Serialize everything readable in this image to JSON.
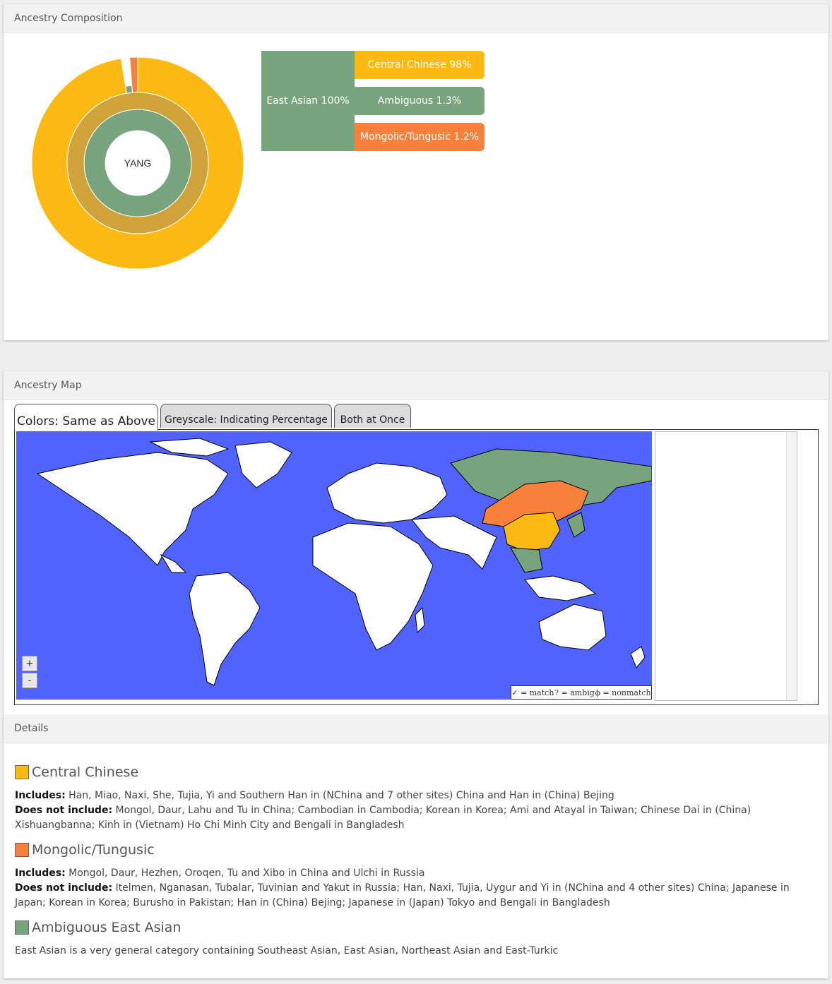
{
  "composition": {
    "header": "Ancestry Composition",
    "center_label": "YANG",
    "colors": {
      "central": "#fdb913",
      "ambiguous": "#78a47d",
      "mongolic": "#f7803b",
      "east_asian_ring": "#cfa23a"
    },
    "top_level": {
      "label": "East Asian 100%",
      "value": 100
    },
    "subgroups": [
      {
        "label": "Central Chinese 98%",
        "value": 97.5,
        "color": "#fdb913"
      },
      {
        "label": "Ambiguous 1.3%",
        "value": 1.3,
        "color": "#78a47d"
      },
      {
        "label": "Mongolic/Tungusic 1.2%",
        "value": 1.2,
        "color": "#f7803b"
      }
    ]
  },
  "map": {
    "header": "Ancestry Map",
    "tabs": [
      {
        "label": "Colors: Same as Above",
        "active": true
      },
      {
        "label": "Greyscale: Indicating Percentage",
        "active": false
      },
      {
        "label": "Both at Once",
        "active": false
      }
    ],
    "zoom_in": "+",
    "zoom_out": "-",
    "legend": [
      "✓ = match",
      "? = ambig",
      "ϕ = nonmatch"
    ]
  },
  "details": {
    "header": "Details",
    "categories": [
      {
        "title": "Central Chinese",
        "color": "#fdb913",
        "includes_label": "Includes:",
        "includes": "Han, Miao, Naxi, She, Tujia, Yi and Southern Han in (NChina and 7 other sites) China and Han in (China) Bejing",
        "excludes_label": "Does not include:",
        "excludes": "Mongol, Daur, Lahu and Tu in China; Cambodian in Cambodia; Korean in Korea; Ami and Atayal in Taiwan; Chinese Dai in (China) Xishuangbanna; Kinh in (Vietnam) Ho Chi Minh City and Bengali in Bangladesh"
      },
      {
        "title": "Mongolic/Tungusic",
        "color": "#f7803b",
        "includes_label": "Includes:",
        "includes": "Mongol, Daur, Hezhen, Oroqen, Tu and Xibo in China and Ulchi in Russia",
        "excludes_label": "Does not include:",
        "excludes": "Itelmen, Nganasan, Tubalar, Tuvinian and Yakut in Russia; Han, Naxi, Tujia, Uygur and Yi in (NChina and 4 other sites) China; Japanese in Japan; Korean in Korea; Burusho in Pakistan; Han in (China) Bejing; Japanese in (Japan) Tokyo and Bengali in Bangladesh"
      },
      {
        "title": "Ambiguous East Asian",
        "color": "#78a47d",
        "description": "East Asian is a very general category containing Southeast Asian, East Asian, Northeast Asian and East-Turkic"
      }
    ]
  }
}
